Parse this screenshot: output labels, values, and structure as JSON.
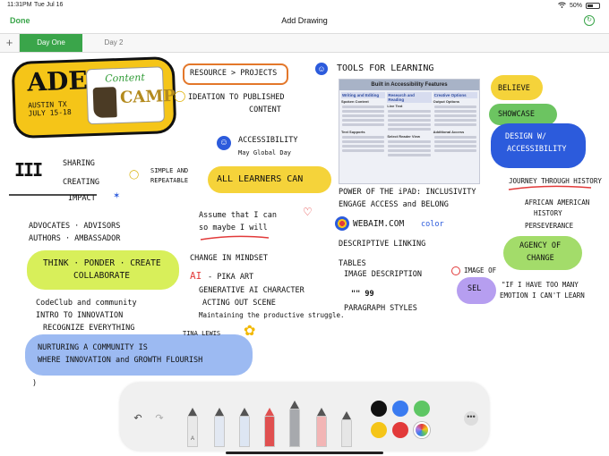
{
  "status": {
    "time": "11:31PM",
    "date": "Tue Jul 16",
    "battery": "50%"
  },
  "nav": {
    "done": "Done",
    "title": "Add Drawing"
  },
  "tabs": {
    "add": "+",
    "items": [
      "Day One",
      "Day 2"
    ]
  },
  "logo": {
    "ade": "ADE",
    "austin": "AUSTIN TX",
    "dates": "JULY 15-18",
    "content": "Content",
    "camp": "CAMP"
  },
  "notes": {
    "resource": "RESOURCE > PROJECTS",
    "ideation": "IDEATION TO PUBLISHED",
    "content": "CONTENT",
    "tools": "TOOLS FOR LEARNING",
    "believe": "BELIEVE",
    "showcase": "SHOWCASE",
    "design1": "DESIGN W/",
    "design2": "ACCESSIBILITY",
    "sharing": "SHARING",
    "creating": "CREATING",
    "impact": "IMPACT",
    "simple": "SIMPLE AND",
    "repeatable": "REPEATABLE",
    "accessibility": "ACCESSIBILITY",
    "global_day": "May Global Day",
    "all_learners": "ALL LEARNERS CAN",
    "assume1": "Assume that I can",
    "assume2": "so maybe I will",
    "advocates": "ADVOCATES · ADVISORS",
    "authors": "AUTHORS · AMBASSADOR",
    "think": "THINK · PONDER · CREATE",
    "collaborate": "COLLABORATE",
    "mindset": "CHANGE IN MINDSET",
    "ai_prefix": "AI",
    "ai_rest": "- PIKA ART",
    "generative": "GENERATIVE AI CHARACTER",
    "acting": "ACTING OUT SCENE",
    "maintaining": "Maintaining the productive struggle.",
    "codeclub": "CodeClub and community",
    "intro": "INTRO TO INNOVATION",
    "recognize": "RECOGNIZE EVERYTHING",
    "nurturing": "NURTURING A COMMUNITY IS",
    "where": "WHERE INNOVATION and GROWTH FLOURISH",
    "tina": "TINA LEWIS",
    "power1": "POWER OF THE iPAD: INCLUSIVITY",
    "power2": "ENGAGE ACCESS and BELONG",
    "webaim": "WEBAIM.COM",
    "color": "color",
    "descriptive": "DESCRIPTIVE LINKING",
    "tables": "TABLES",
    "image_desc": "IMAGE DESCRIPTION",
    "image_of": "IMAGE OF",
    "quotes": "\"\" 99",
    "paragraph": "PARAGRAPH STYLES",
    "sel": "SEL",
    "if_have1": "\"IF I HAVE TOO MANY",
    "if_have2": "EMOTION I CAN'T LEARN",
    "journey": "JOURNEY THROUGH HISTORY",
    "african1": "AFRICAN AMERICAN",
    "african2": "HISTORY",
    "perseverance": "PERSEVERANCE",
    "agency1": "AGENCY OF",
    "agency2": "CHANGE",
    "paren": ")"
  },
  "screenshot": {
    "title": "Built in Accessibility Features",
    "columns": [
      {
        "head": "Writing and Editing",
        "sub": "Spoken Content",
        "sub2": "Text Supports"
      },
      {
        "head": "Research and Reading",
        "sub": "Live Text",
        "sub2": "Select Reader View"
      },
      {
        "head": "Creative Options",
        "sub": "Output Options",
        "sub2": "Additional Access"
      }
    ]
  },
  "toolbar": {
    "undo": "↶",
    "redo": "↷",
    "more": "•••",
    "tools": [
      {
        "name": "pen",
        "label": "A",
        "color": "#e9e9e9"
      },
      {
        "name": "marker",
        "label": "",
        "color": "#e2e8f2"
      },
      {
        "name": "fountain-pen",
        "label": "",
        "color": "#dde6f3"
      },
      {
        "name": "crayon",
        "label": "",
        "color": "#e05050"
      },
      {
        "name": "fill",
        "label": "",
        "color": "#a7a9ad"
      },
      {
        "name": "eraser",
        "label": "",
        "color": "#f2b5b5"
      },
      {
        "name": "pencil",
        "label": "",
        "color": "#e6e6e6"
      }
    ],
    "colors": [
      "#111111",
      "#3a7bf0",
      "#5ec664",
      "#f5c518",
      "#e23a3a",
      "#b07ee0"
    ]
  },
  "colors": {
    "green": "#3aa54a",
    "yellow": "#f5d33a",
    "lime": "#cfe84f",
    "blue": "#2c5bdc",
    "lightblue": "#8fb0f0",
    "purple": "#b69ef0",
    "orange": "#e3772a",
    "red": "#e23a3a"
  }
}
